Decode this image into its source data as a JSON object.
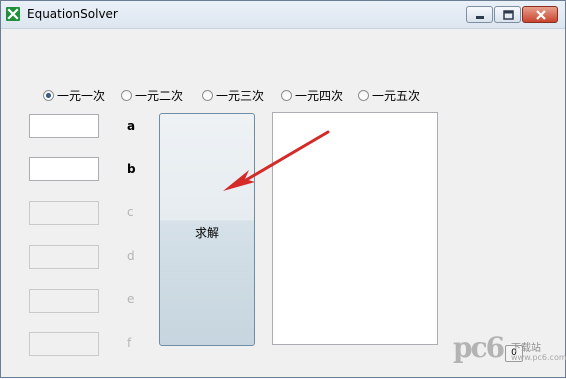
{
  "window": {
    "title": "EquationSolver",
    "icon": "excel-app-icon",
    "buttons": [
      "minimize-icon",
      "maximize-icon",
      "close-icon"
    ]
  },
  "radios": [
    {
      "label": "一元一次",
      "checked": true
    },
    {
      "label": "一元二次",
      "checked": false
    },
    {
      "label": "一元三次",
      "checked": false
    },
    {
      "label": "一元四次",
      "checked": false
    },
    {
      "label": "一元五次",
      "checked": false
    }
  ],
  "coefficients": [
    {
      "label": "a",
      "value": "",
      "enabled": true
    },
    {
      "label": "b",
      "value": "",
      "enabled": true
    },
    {
      "label": "c",
      "value": "",
      "enabled": false
    },
    {
      "label": "d",
      "value": "",
      "enabled": false
    },
    {
      "label": "e",
      "value": "",
      "enabled": false
    },
    {
      "label": "f",
      "value": "",
      "enabled": false
    }
  ],
  "solve_button": {
    "label": "求解"
  },
  "output": {
    "value": ""
  },
  "annotation": {
    "color": "#d42a2a"
  },
  "watermark": {
    "logo": "pc6",
    "text": "下载站",
    "url": "www.pc6.com"
  }
}
